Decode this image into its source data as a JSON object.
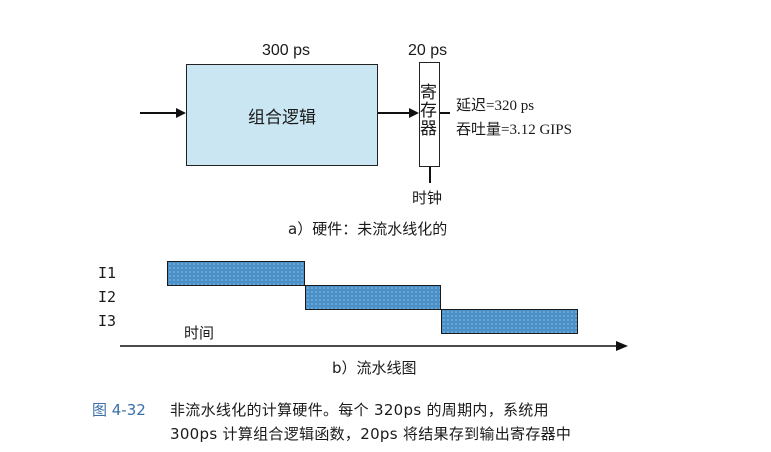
{
  "part_a": {
    "logic_delay": "300 ps",
    "register_delay": "20 ps",
    "logic_label": "组合逻辑",
    "register_label": "寄存器",
    "latency": "延迟=320 ps",
    "throughput": "吞吐量=3.12 GIPS",
    "clock_label": "时钟",
    "caption": "a）硬件：未流水线化的"
  },
  "part_b": {
    "instructions": [
      "I1",
      "I2",
      "I3"
    ],
    "time_label": "时间",
    "caption": "b）流水线图"
  },
  "figure": {
    "number": "图 4-32",
    "caption_line1": "非流水线化的计算硬件。每个 320ps 的周期内，系统用",
    "caption_line2": "300ps 计算组合逻辑函数，20ps 将结果存到输出寄存器中"
  }
}
